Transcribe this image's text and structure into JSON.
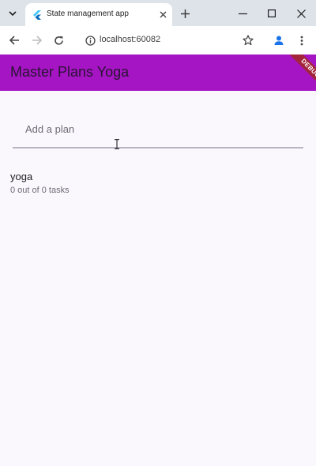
{
  "browser": {
    "tab_title": "State management app",
    "url": "localhost:60082",
    "icons": {
      "tab_menu": "chevron-down-icon",
      "tab_close": "close-icon",
      "new_tab": "plus-icon",
      "minimize": "minimize-icon",
      "maximize": "maximize-icon",
      "window_close": "close-icon",
      "back": "arrow-left-icon",
      "forward": "arrow-right-icon",
      "reload": "reload-icon",
      "site_info": "info-icon",
      "bookmark": "star-icon",
      "profile": "person-icon",
      "menu": "more-vert-icon"
    }
  },
  "app": {
    "title": "Master Plans Yoga",
    "debug_label": "DEBUG",
    "colors": {
      "appbar": "#a515c4",
      "debug_banner": "#a3253a",
      "background": "#fbf8fd"
    },
    "input": {
      "placeholder": "Add a plan",
      "value": ""
    },
    "plans": [
      {
        "name": "yoga",
        "summary": "0 out of 0 tasks"
      }
    ]
  }
}
